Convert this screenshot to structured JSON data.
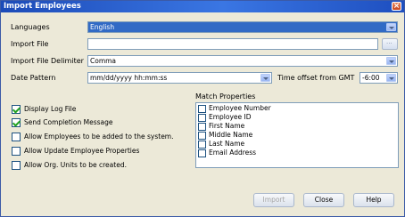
{
  "window": {
    "title": "Import Employees"
  },
  "fields": {
    "languages": {
      "label": "Languages",
      "value": "English"
    },
    "import_file": {
      "label": "Import File",
      "value": ""
    },
    "delimiter": {
      "label": "Import File Delimiter",
      "value": "Comma"
    },
    "date_pattern": {
      "label": "Date Pattern",
      "value": "mm/dd/yyyy hh:mm:ss"
    },
    "gmt_offset": {
      "label": "Time offset from GMT",
      "value": "-6:00"
    }
  },
  "options": [
    {
      "label": "Display Log File",
      "checked": true
    },
    {
      "label": "Send Completion Message",
      "checked": true
    },
    {
      "label": "Allow Employees to be added to the system.",
      "checked": false
    },
    {
      "label": "Allow Update Employee Properties",
      "checked": false
    },
    {
      "label": "Allow Org. Units to be created.",
      "checked": false
    }
  ],
  "match_properties": {
    "label": "Match Properties",
    "items": [
      "Employee Number",
      "Employee ID",
      "First Name",
      "Middle Name",
      "Last Name",
      "Email Address"
    ]
  },
  "buttons": {
    "import": "Import",
    "close": "Close",
    "help": "Help"
  },
  "colors": {
    "titlebar": "#1c4bb8",
    "selection": "#316ac5",
    "window_bg": "#ece9d8"
  }
}
